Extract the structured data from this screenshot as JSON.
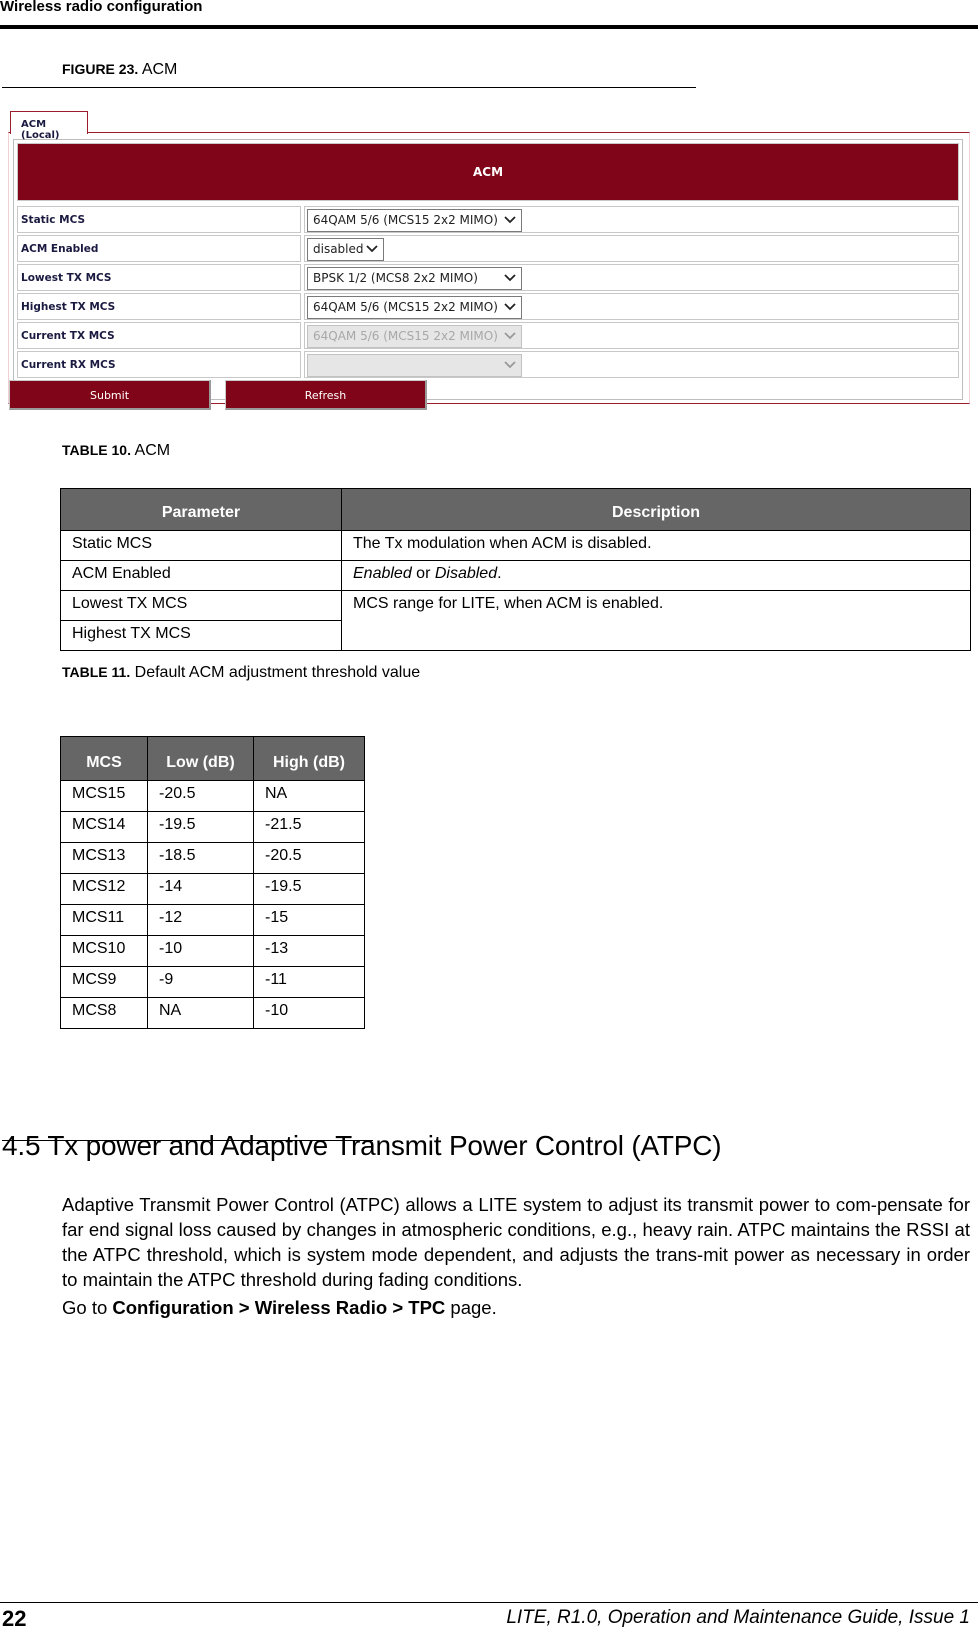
{
  "header": {
    "running_title": "Wireless radio configuration"
  },
  "figure": {
    "label": "FIGURE 23.",
    "title": "ACM"
  },
  "acm_ui": {
    "tab_label": "ACM (Local)",
    "panel_title": "ACM",
    "rows": [
      {
        "label": "Static MCS",
        "value": "64QAM 5/6 (MCS15 2x2 MIMO)",
        "disabled": false
      },
      {
        "label": "ACM Enabled",
        "value": "disabled",
        "disabled": false
      },
      {
        "label": "Lowest TX MCS",
        "value": "BPSK 1/2 (MCS8 2x2 MIMO)",
        "disabled": false
      },
      {
        "label": "Highest TX MCS",
        "value": "64QAM 5/6 (MCS15 2x2 MIMO)",
        "disabled": false
      },
      {
        "label": "Current TX MCS",
        "value": "64QAM 5/6 (MCS15 2x2 MIMO)",
        "disabled": true
      },
      {
        "label": "Current RX MCS",
        "value": "",
        "disabled": true
      }
    ],
    "submit_label": "Submit",
    "refresh_label": "Refresh",
    "accent_color": "#800518"
  },
  "table10": {
    "label": "TABLE 10.",
    "title": "ACM",
    "headers": [
      "Parameter",
      "Description"
    ],
    "rows": [
      {
        "param": "Static MCS",
        "desc": "The Tx modulation when ACM is disabled."
      },
      {
        "param": "ACM Enabled",
        "desc_italic1": "Enabled",
        "desc_mid": " or ",
        "desc_italic2": "Disabled",
        "desc_end": "."
      },
      {
        "param": "Lowest TX MCS",
        "desc": "MCS range for LITE, when ACM is enabled."
      },
      {
        "param": "Highest TX MCS"
      }
    ]
  },
  "table11": {
    "label": "TABLE 11.",
    "title": "Default ACM adjustment threshold value",
    "headers": [
      "MCS",
      "Low (dB)",
      "High (dB)"
    ],
    "rows": [
      [
        "MCS15",
        "-20.5",
        "NA"
      ],
      [
        "MCS14",
        "-19.5",
        "-21.5"
      ],
      [
        "MCS13",
        "-18.5",
        "-20.5"
      ],
      [
        "MCS12",
        "-14",
        "-19.5"
      ],
      [
        "MCS11",
        "-12",
        "-15"
      ],
      [
        "MCS10",
        "-10",
        "-13"
      ],
      [
        "MCS9",
        "-9",
        "-11"
      ],
      [
        "MCS8",
        "NA",
        "-10"
      ]
    ]
  },
  "section": {
    "title": "4.5 Tx power and Adaptive Transmit Power Control (ATPC)",
    "paragraph": "Adaptive Transmit Power Control (ATPC) allows a LITE system to adjust its transmit power to com-pensate for far end signal loss caused by changes in atmospheric conditions, e.g., heavy rain. ATPC maintains the RSSI at the ATPC threshold, which is system mode dependent, and adjusts the trans-mit power as necessary in order to maintain the ATPC threshold during fading conditions.",
    "goto_prefix": "Go to ",
    "goto_path": "Configuration > Wireless Radio > TPC",
    "goto_suffix": " page."
  },
  "footer": {
    "page_number": "22",
    "doc_title": "LITE, R1.0, Operation and Maintenance Guide, Issue 1"
  }
}
